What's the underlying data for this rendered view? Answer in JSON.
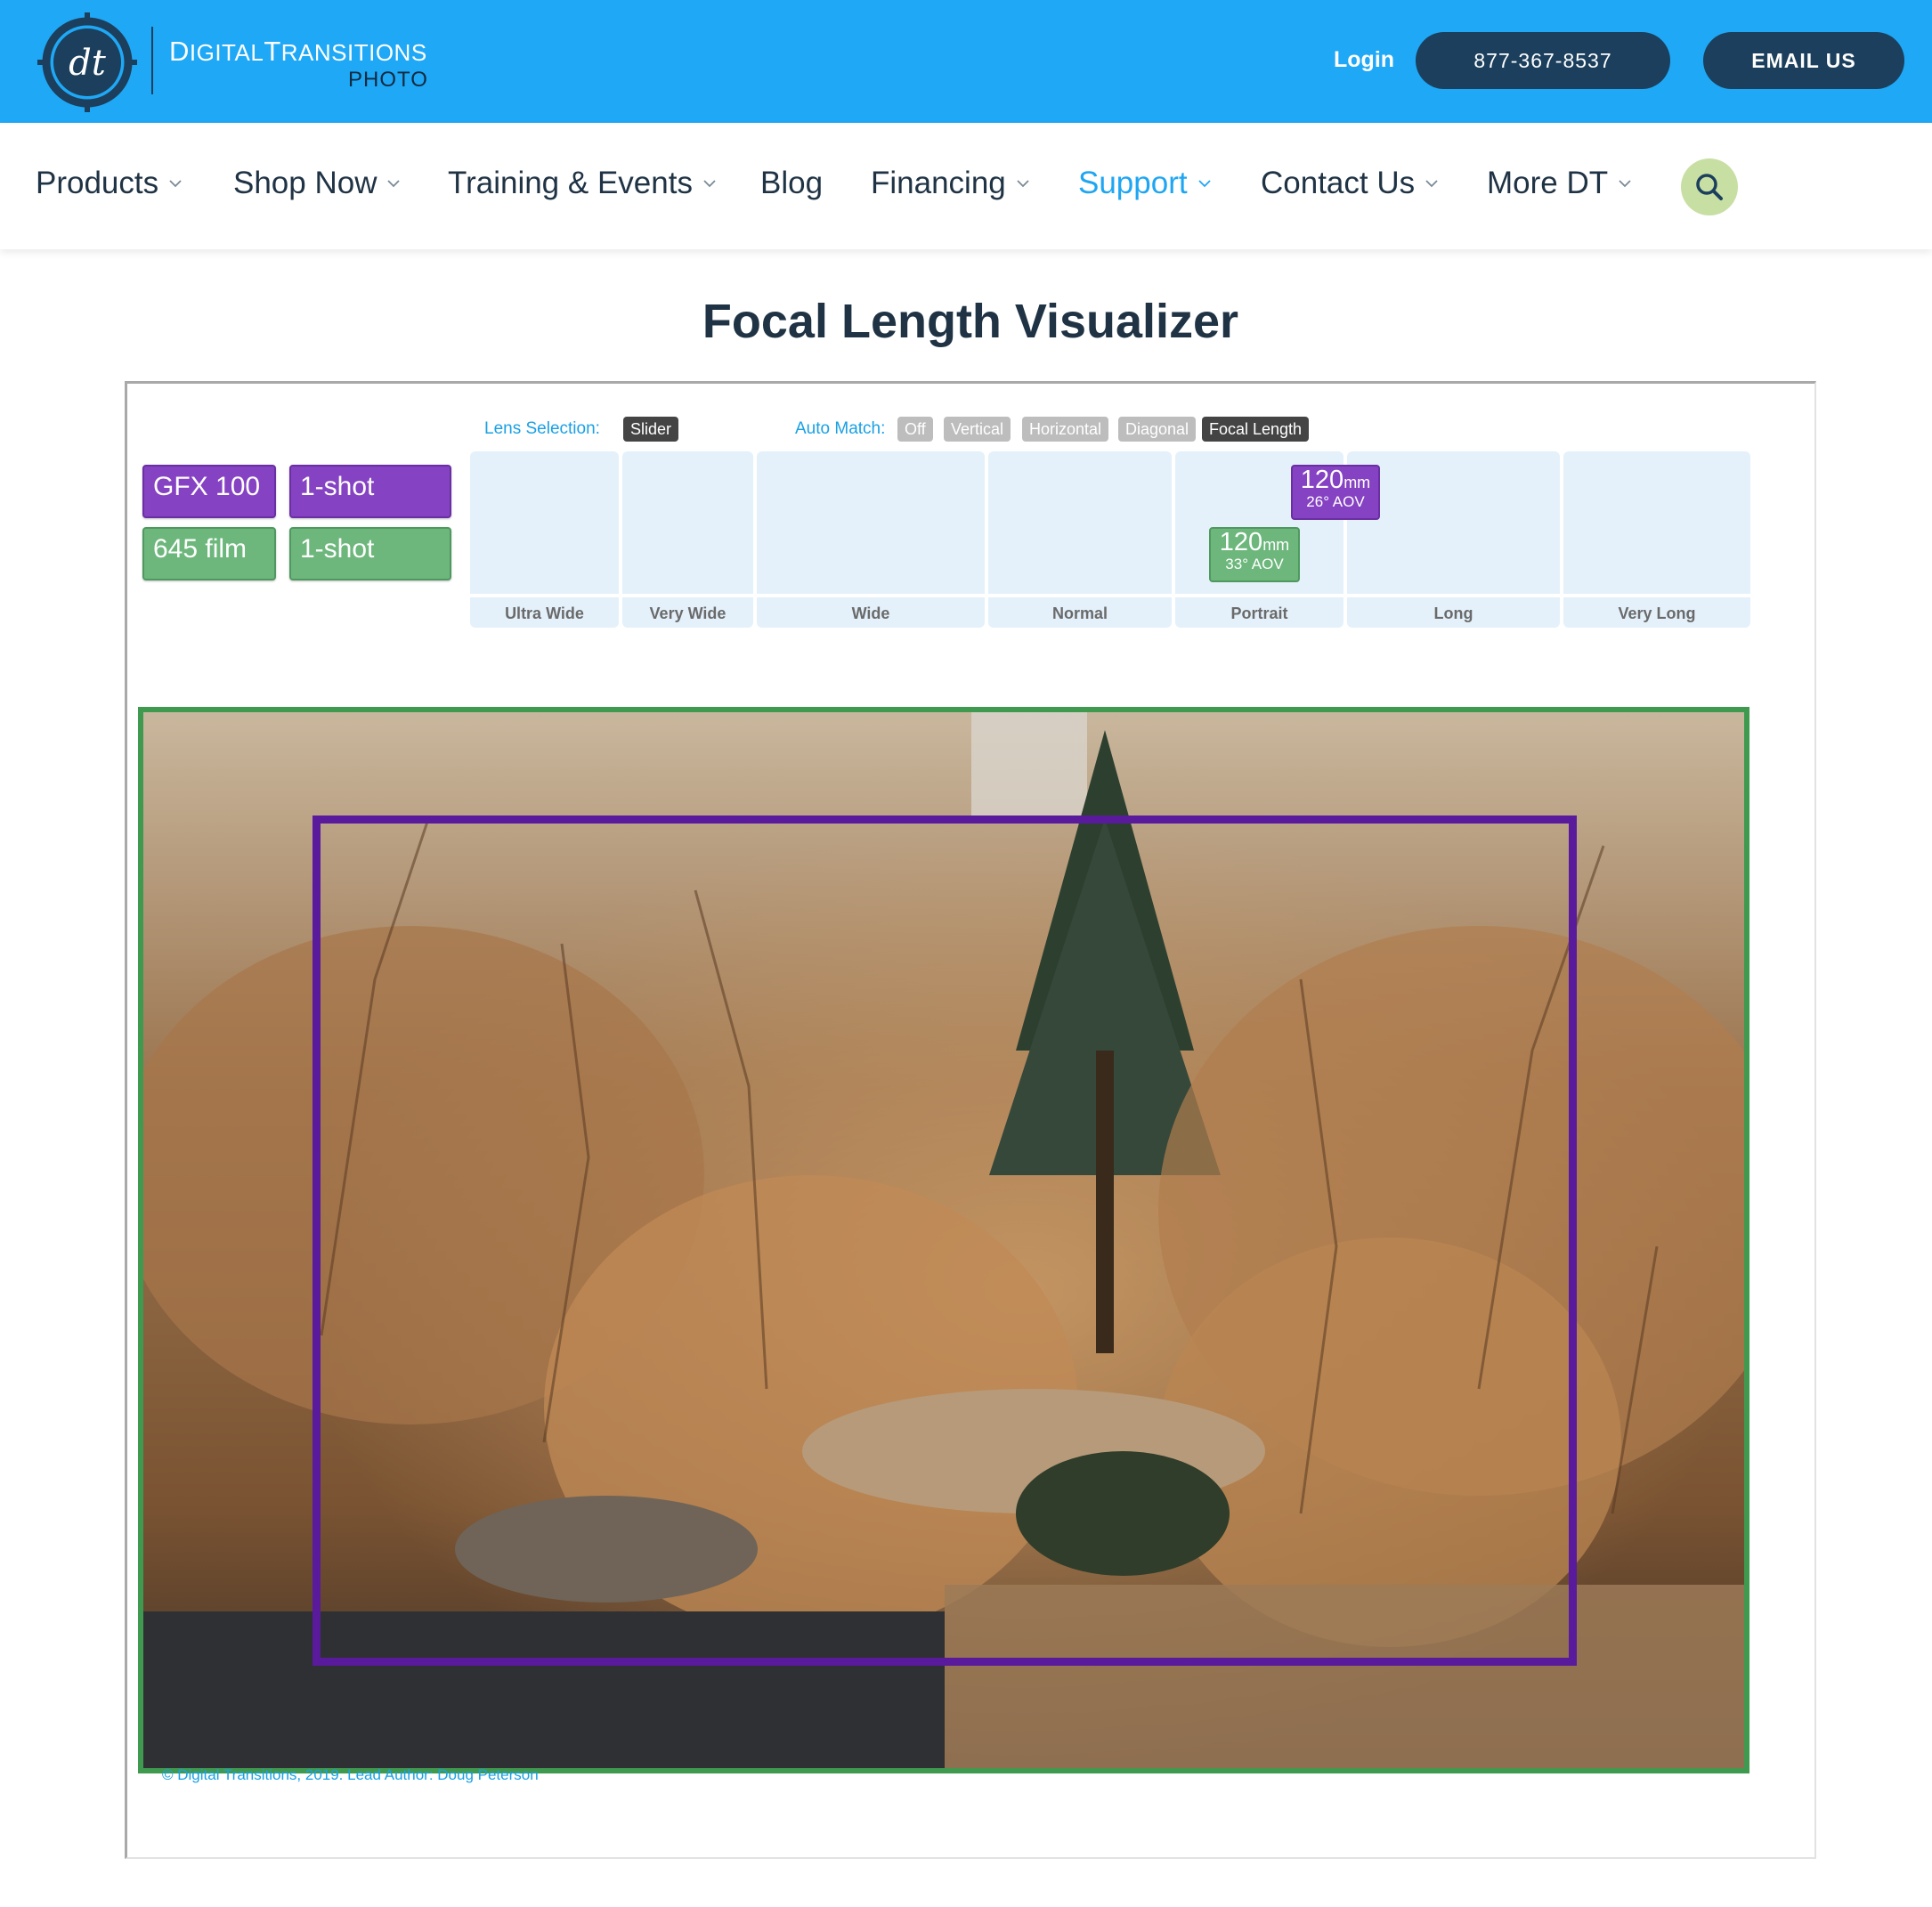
{
  "brand": {
    "name_part1": "D",
    "name_part1_rest": "IGITAL",
    "name_part2": "T",
    "name_part2_rest": "RANSITIONS",
    "sub": "PHOTO",
    "logo_letters": "dt"
  },
  "header": {
    "login": "Login",
    "phone": "877-367-8537",
    "email": "EMAIL US"
  },
  "nav": {
    "items": [
      {
        "label": "Products"
      },
      {
        "label": "Shop Now"
      },
      {
        "label": "Training & Events"
      },
      {
        "label": "Blog"
      },
      {
        "label": "Financing"
      },
      {
        "label": "Support"
      },
      {
        "label": "Contact Us"
      },
      {
        "label": "More DT"
      }
    ],
    "active": "Support",
    "search_icon": "search-icon"
  },
  "page": {
    "title": "Focal Length Visualizer"
  },
  "visualizer": {
    "lens_selection_label": "Lens Selection:",
    "lens_selection_value": "Slider",
    "auto_match_label": "Auto Match:",
    "auto_match_options": [
      "Off",
      "Vertical",
      "Horizontal",
      "Diagonal",
      "Focal Length"
    ],
    "auto_match_selected": "Focal Length",
    "cameras": [
      {
        "body": "GFX 100",
        "mode": "1-shot",
        "color": "#8542c2"
      },
      {
        "body": "645 film",
        "mode": "1-shot",
        "color": "#6db77c"
      }
    ],
    "ranges": [
      "Ultra Wide",
      "Very Wide",
      "Wide",
      "Normal",
      "Portrait",
      "Long",
      "Very Long"
    ],
    "markers": [
      {
        "focal": "120",
        "unit": "mm",
        "aov": "26° AOV",
        "color": "#8542c2"
      },
      {
        "focal": "120",
        "unit": "mm",
        "aov": "33° AOV",
        "color": "#6db77c"
      }
    ],
    "credit": "© Digital Transitions, 2019. Lead Author: Doug Peterson"
  }
}
